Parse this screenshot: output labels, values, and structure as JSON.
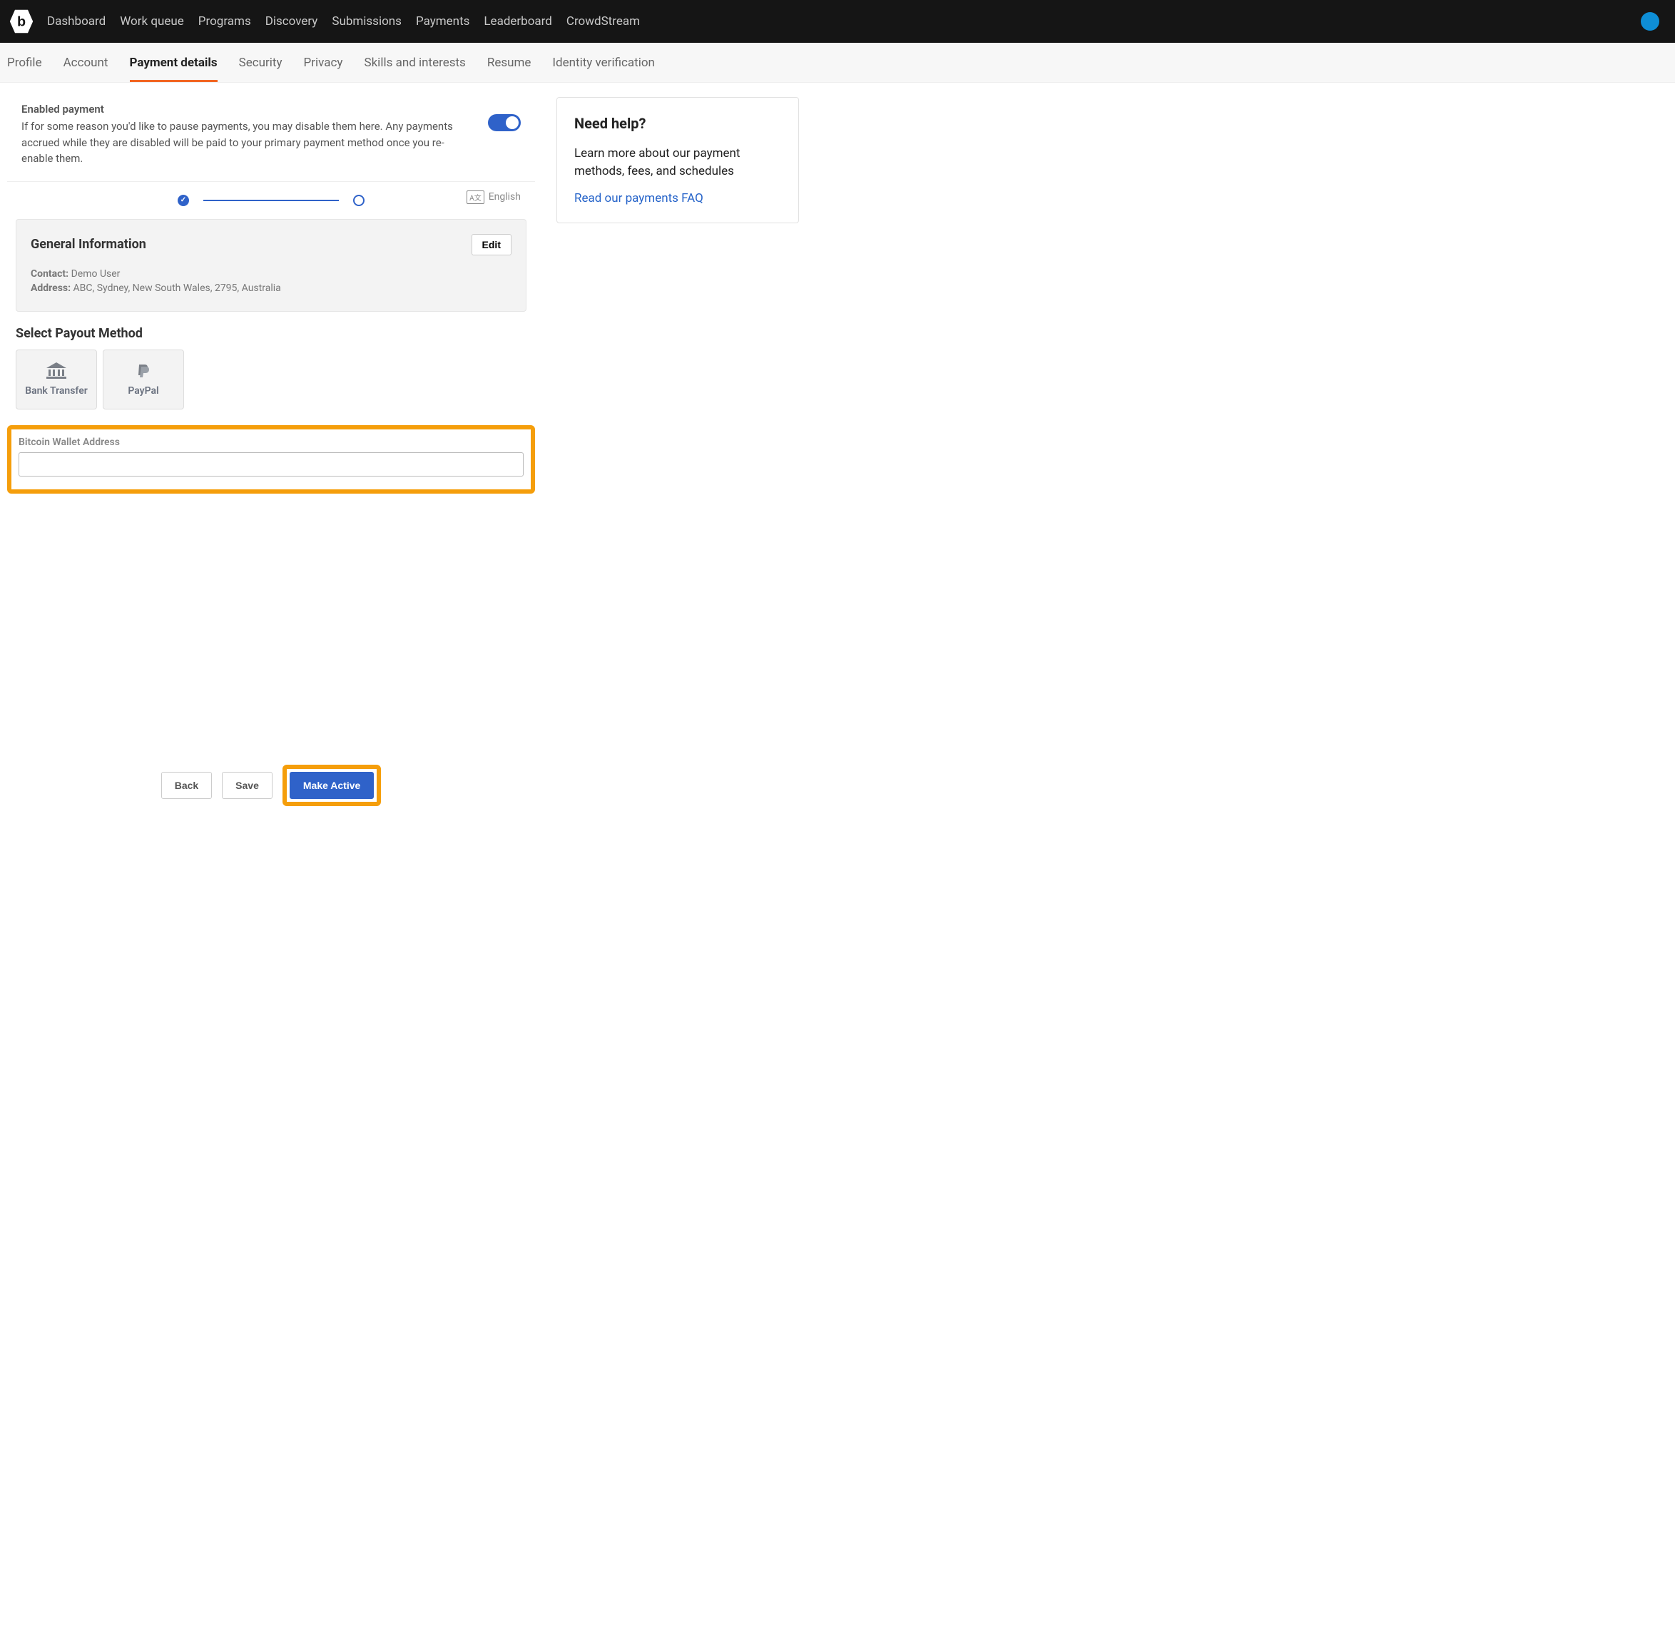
{
  "topnav": {
    "items": [
      "Dashboard",
      "Work queue",
      "Programs",
      "Discovery",
      "Submissions",
      "Payments",
      "Leaderboard",
      "CrowdStream"
    ]
  },
  "subnav": {
    "items": [
      "Profile",
      "Account",
      "Payment details",
      "Security",
      "Privacy",
      "Skills and interests",
      "Resume",
      "Identity verification"
    ],
    "active_index": 2
  },
  "enabled_payment": {
    "title": "Enabled payment",
    "desc": "If for some reason you'd like to pause payments, you may disable them here. Any payments accrued while they are disabled will be paid to your primary payment method once you re-enable them."
  },
  "language_label": "English",
  "general_info": {
    "heading": "General Information",
    "edit_label": "Edit",
    "contact_label": "Contact:",
    "contact_value": "Demo User",
    "address_label": "Address:",
    "address_value": "ABC, Sydney, New South Wales, 2795, Australia"
  },
  "payout": {
    "heading": "Select Payout Method",
    "methods": [
      "Bank Transfer",
      "PayPal"
    ]
  },
  "bitcoin": {
    "label": "Bitcoin Wallet Address",
    "value": ""
  },
  "footer": {
    "back": "Back",
    "save": "Save",
    "make_active": "Make Active"
  },
  "help": {
    "heading": "Need help?",
    "body": "Learn more about our payment methods, fees, and schedules",
    "link": "Read our payments FAQ"
  }
}
